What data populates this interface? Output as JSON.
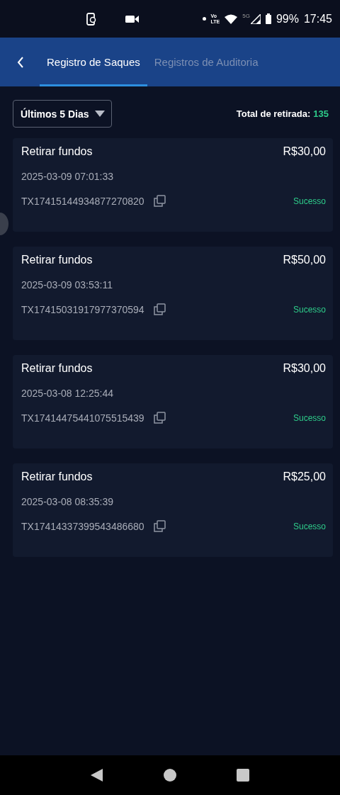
{
  "status_bar": {
    "volte": [
      "Vo",
      "LTE"
    ],
    "network": "5G",
    "battery": "99%",
    "time": "17:45"
  },
  "header": {
    "tabs": [
      {
        "label": "Registro de Saques",
        "selected": true
      },
      {
        "label": "Registros de Auditoria",
        "selected": false
      }
    ]
  },
  "filter": {
    "label": "Últimos 5 Dias"
  },
  "total": {
    "label": "Total de retirada:",
    "value": "135"
  },
  "records": [
    {
      "title": "Retirar fundos",
      "amount": "R$30,00",
      "datetime": "2025-03-09 07:01:33",
      "id": "TX17415144934877270820",
      "status": "Sucesso"
    },
    {
      "title": "Retirar fundos",
      "amount": "R$50,00",
      "datetime": "2025-03-09 03:53:11",
      "id": "TX17415031917977370594",
      "status": "Sucesso"
    },
    {
      "title": "Retirar fundos",
      "amount": "R$30,00",
      "datetime": "2025-03-08 12:25:44",
      "id": "TX17414475441075515439",
      "status": "Sucesso"
    },
    {
      "title": "Retirar fundos",
      "amount": "R$25,00",
      "datetime": "2025-03-08 08:35:39",
      "id": "TX17414337399543486680",
      "status": "Sucesso"
    }
  ]
}
